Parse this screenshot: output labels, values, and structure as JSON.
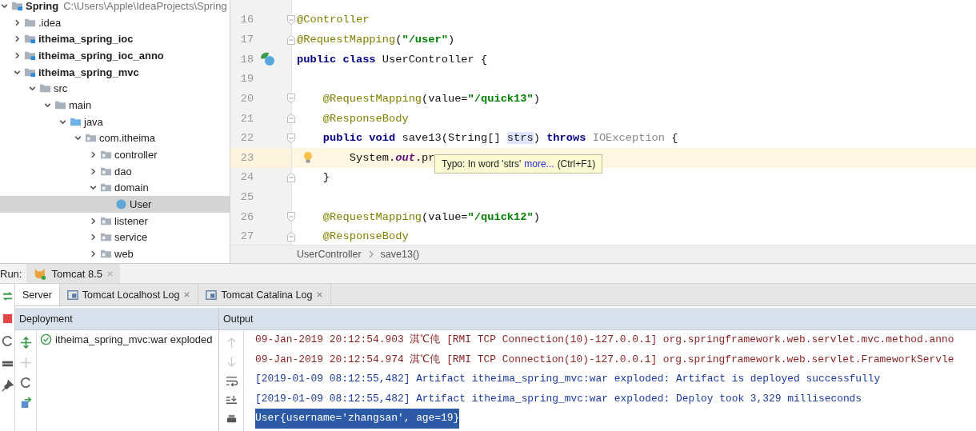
{
  "project_tree": [
    {
      "label": "Spring",
      "path": "C:\\Users\\Apple\\IdeaProjects\\Spring",
      "kind": "module",
      "bold": true,
      "expanded": true,
      "selected": false,
      "children": [
        {
          "label": ".idea",
          "kind": "folder",
          "bold": false,
          "expanded": false,
          "selected": false
        },
        {
          "label": "itheima_spring_ioc",
          "kind": "module",
          "bold": true,
          "expanded": false,
          "selected": false
        },
        {
          "label": "itheima_spring_ioc_anno",
          "kind": "module",
          "bold": true,
          "expanded": false,
          "selected": false
        },
        {
          "label": "itheima_spring_mvc",
          "kind": "module",
          "bold": true,
          "expanded": true,
          "selected": false,
          "children": [
            {
              "label": "src",
              "kind": "folder",
              "bold": false,
              "expanded": true,
              "selected": false,
              "children": [
                {
                  "label": "main",
                  "kind": "folder",
                  "bold": false,
                  "expanded": true,
                  "selected": false,
                  "children": [
                    {
                      "label": "java",
                      "kind": "source",
                      "bold": false,
                      "expanded": true,
                      "selected": false,
                      "children": [
                        {
                          "label": "com.itheima",
                          "kind": "package",
                          "bold": false,
                          "expanded": true,
                          "selected": false,
                          "children": [
                            {
                              "label": "controller",
                              "kind": "package",
                              "bold": false,
                              "expanded": false,
                              "selected": false
                            },
                            {
                              "label": "dao",
                              "kind": "package",
                              "bold": false,
                              "expanded": false,
                              "selected": false
                            },
                            {
                              "label": "domain",
                              "kind": "package",
                              "bold": false,
                              "expanded": true,
                              "selected": false,
                              "children": [
                                {
                                  "label": "User",
                                  "kind": "class",
                                  "bold": false,
                                  "selected": true
                                }
                              ]
                            },
                            {
                              "label": "listener",
                              "kind": "package",
                              "bold": false,
                              "expanded": false,
                              "selected": false
                            },
                            {
                              "label": "service",
                              "kind": "package",
                              "bold": false,
                              "expanded": false,
                              "selected": false
                            },
                            {
                              "label": "web",
                              "kind": "package",
                              "bold": false,
                              "expanded": false,
                              "selected": false
                            }
                          ]
                        }
                      ]
                    }
                  ]
                }
              ]
            }
          ]
        }
      ]
    }
  ],
  "editor": {
    "lines": [
      {
        "number": "16",
        "current": false,
        "fold": {
          "kind": "start"
        },
        "tokens": [
          {
            "kind": "annotation",
            "text": "@Controller"
          }
        ]
      },
      {
        "number": "17",
        "current": false,
        "fold": {
          "kind": "end"
        },
        "tokens": [
          {
            "kind": "annotation",
            "text": "@RequestMapping"
          },
          {
            "kind": "plain",
            "text": "("
          },
          {
            "kind": "string",
            "text": "\"/user\""
          },
          {
            "kind": "plain",
            "text": ")"
          }
        ]
      },
      {
        "number": "18",
        "current": false,
        "marker": {
          "kind": "bean"
        },
        "tokens": [
          {
            "kind": "keyword",
            "text": "public class"
          },
          {
            "kind": "plain",
            "text": " UserController {"
          }
        ]
      },
      {
        "number": "19",
        "current": false
      },
      {
        "number": "20",
        "current": false,
        "fold": {
          "kind": "start"
        },
        "tokens": [
          {
            "kind": "annotation",
            "text": "    @RequestMapping"
          },
          {
            "kind": "plain",
            "text": "(value="
          },
          {
            "kind": "string",
            "text": "\"/quick13\""
          },
          {
            "kind": "plain",
            "text": ")"
          }
        ]
      },
      {
        "number": "21",
        "current": false,
        "fold": {
          "kind": "end"
        },
        "tokens": [
          {
            "kind": "annotation",
            "text": "    @ResponseBody"
          }
        ]
      },
      {
        "number": "22",
        "current": false,
        "fold": {
          "kind": "start"
        },
        "tokens": [
          {
            "kind": "keyword",
            "text": "    public void"
          },
          {
            "kind": "plain",
            "text": " save13(String[] "
          },
          {
            "kind": "typo",
            "text": "strs"
          },
          {
            "kind": "plain",
            "text": ") "
          },
          {
            "kind": "keyword",
            "text": "throws"
          },
          {
            "kind": "muted",
            "text": " IOException"
          },
          {
            "kind": "plain",
            "text": " {"
          }
        ]
      },
      {
        "number": "23",
        "current": true,
        "marker": {
          "kind": "bulb"
        },
        "tokens": [
          {
            "kind": "plain",
            "text": "        System."
          },
          {
            "kind": "field",
            "text": "out"
          },
          {
            "kind": "plain",
            "text": ".pr"
          }
        ]
      },
      {
        "number": "24",
        "current": false,
        "fold": {
          "kind": "end"
        },
        "tokens": [
          {
            "kind": "plain",
            "text": "    }"
          }
        ]
      },
      {
        "number": "25",
        "current": false
      },
      {
        "number": "26",
        "current": false,
        "fold": {
          "kind": "start"
        },
        "tokens": [
          {
            "kind": "annotation",
            "text": "    @RequestMapping"
          },
          {
            "kind": "plain",
            "text": "(value="
          },
          {
            "kind": "string",
            "text": "\"/quick12\""
          },
          {
            "kind": "plain",
            "text": ")"
          }
        ]
      },
      {
        "number": "27",
        "current": false,
        "fold": {
          "kind": "end"
        },
        "tokens": [
          {
            "kind": "annotation",
            "text": "    @ResponseBody"
          }
        ]
      }
    ],
    "tooltip": {
      "text": "Typo: In word 'strs'",
      "link": "more...",
      "shortcut": "(Ctrl+F1)"
    },
    "breadcrumb": [
      "UserController",
      "save13()"
    ]
  },
  "run": {
    "label": "Run:",
    "tab": "Tomcat 8.5"
  },
  "tool_tabs": [
    {
      "label": "Server",
      "selected": true,
      "closable": false
    },
    {
      "label": "Tomcat Localhost Log",
      "selected": false,
      "closable": true
    },
    {
      "label": "Tomcat Catalina Log",
      "selected": false,
      "closable": true
    }
  ],
  "deployment": {
    "title": "Deployment",
    "items": [
      {
        "label": "itheima_spring_mvc:war exploded",
        "kind": "deployed"
      }
    ]
  },
  "output": {
    "title": "Output",
    "lines": [
      {
        "kind": "stderr",
        "selected": false,
        "text": "09-Jan-2019 20:12:54.903 淇℃伅 [RMI TCP Connection(10)-127.0.0.1] org.springframework.web.servlet.mvc.method.anno"
      },
      {
        "kind": "stderr",
        "selected": false,
        "text": "09-Jan-2019 20:12:54.974 淇℃伅 [RMI TCP Connection(10)-127.0.0.1] org.springframework.web.servlet.FrameworkServle"
      },
      {
        "kind": "info",
        "selected": false,
        "text": "[2019-01-09 08:12:55,482] Artifact itheima_spring_mvc:war exploded: Artifact is deployed successfully"
      },
      {
        "kind": "info",
        "selected": false,
        "text": "[2019-01-09 08:12:55,482] Artifact itheima_spring_mvc:war exploded: Deploy took 3,329 milliseconds"
      },
      {
        "kind": "stdout",
        "selected": true,
        "text": "User{username='zhangsan', age=19}"
      }
    ]
  }
}
